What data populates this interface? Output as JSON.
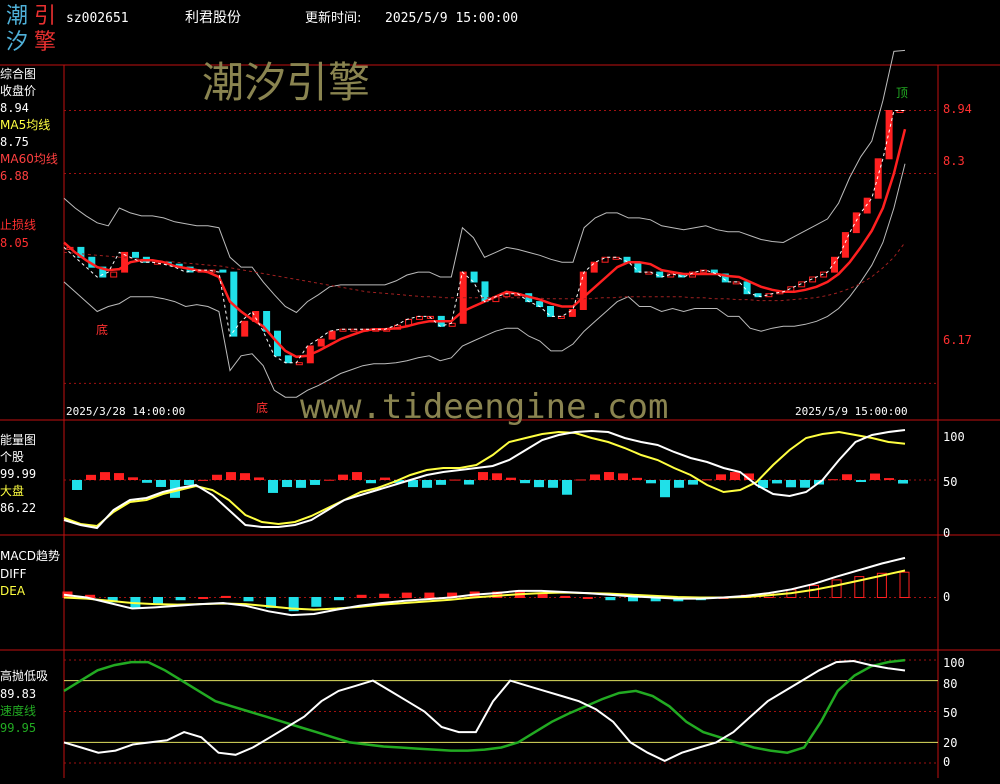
{
  "logo": {
    "chars": [
      "潮",
      "引",
      "汐",
      "擎"
    ]
  },
  "header": {
    "code": "sz002651",
    "name": "利君股份",
    "update_label": "更新时间:",
    "update_time": "2025/5/9 15:00:00"
  },
  "watermark": {
    "brand": "潮汐引擎",
    "url": "www.tideengine.com"
  },
  "colors": {
    "red": "#ff2020",
    "cyan": "#20e0e8",
    "yellow": "#ffff40",
    "green": "#22aa22",
    "frame": "#c01010"
  },
  "panel_main": {
    "title": "综合图",
    "close_label": "收盘价",
    "close_value": "8.94",
    "ma5_label": "MA5均线",
    "ma5_value": "8.75",
    "ma60_label": "MA60均线",
    "ma60_value": "6.88",
    "stop_label": "止损线",
    "stop_value": "8.05",
    "axis_labels": [
      "8.94",
      "8.3",
      "6.17"
    ],
    "date_start": "2025/3/28 14:00:00",
    "date_end": "2025/5/9 15:00:00",
    "marker_bottom": "底",
    "marker_top": "顶"
  },
  "panel_energy": {
    "title": "能量图",
    "stock_label": "个股",
    "stock_value": "99.99",
    "market_label": "大盘",
    "market_value": "86.22",
    "axis_labels": [
      "100",
      "50",
      "0"
    ]
  },
  "panel_macd": {
    "title": "MACD趋势",
    "diff_label": "DIFF",
    "dea_label": "DEA",
    "axis_labels": [
      "0"
    ]
  },
  "panel_speed": {
    "title": "高抛低吸",
    "value": "89.83",
    "speed_label": "速度线",
    "speed_value": "99.95",
    "axis_labels": [
      "100",
      "80",
      "50",
      "20",
      "0"
    ]
  },
  "chart_data": {
    "type": "line",
    "x_range": [
      "2025/3/28 14:00:00",
      "2025/5/9 15:00:00"
    ],
    "price_close": [
      7.55,
      7.45,
      7.35,
      7.25,
      7.3,
      7.5,
      7.45,
      7.4,
      7.4,
      7.38,
      7.35,
      7.3,
      7.32,
      7.32,
      7.3,
      6.65,
      6.8,
      6.9,
      6.7,
      6.45,
      6.38,
      6.38,
      6.55,
      6.62,
      6.7,
      6.72,
      6.72,
      6.72,
      6.72,
      6.72,
      6.76,
      6.82,
      6.85,
      6.85,
      6.75,
      6.78,
      7.3,
      7.2,
      7.0,
      7.05,
      7.08,
      7.08,
      7.0,
      6.95,
      6.85,
      6.85,
      6.92,
      7.3,
      7.4,
      7.45,
      7.45,
      7.4,
      7.3,
      7.3,
      7.25,
      7.28,
      7.25,
      7.3,
      7.32,
      7.28,
      7.2,
      7.2,
      7.08,
      7.05,
      7.08,
      7.1,
      7.15,
      7.2,
      7.25,
      7.3,
      7.45,
      7.7,
      7.9,
      8.05,
      8.45,
      8.94,
      8.94
    ],
    "ma5": [
      7.6,
      7.5,
      7.42,
      7.35,
      7.32,
      7.33,
      7.4,
      7.42,
      7.42,
      7.4,
      7.36,
      7.34,
      7.32,
      7.3,
      7.25,
      7.0,
      6.9,
      6.82,
      6.75,
      6.62,
      6.5,
      6.44,
      6.45,
      6.5,
      6.56,
      6.62,
      6.66,
      6.7,
      6.72,
      6.72,
      6.73,
      6.75,
      6.78,
      6.8,
      6.8,
      6.8,
      6.9,
      6.95,
      7.0,
      7.05,
      7.1,
      7.08,
      7.05,
      7.02,
      6.98,
      6.95,
      6.95,
      7.05,
      7.15,
      7.25,
      7.35,
      7.4,
      7.4,
      7.38,
      7.32,
      7.3,
      7.28,
      7.28,
      7.28,
      7.28,
      7.26,
      7.25,
      7.2,
      7.15,
      7.12,
      7.1,
      7.1,
      7.12,
      7.15,
      7.2,
      7.28,
      7.4,
      7.55,
      7.72,
      7.95,
      8.3,
      8.75
    ],
    "ma60": [
      7.5,
      7.49,
      7.48,
      7.47,
      7.46,
      7.45,
      7.44,
      7.43,
      7.42,
      7.41,
      7.4,
      7.39,
      7.38,
      7.37,
      7.36,
      7.34,
      7.32,
      7.3,
      7.28,
      7.26,
      7.24,
      7.22,
      7.2,
      7.18,
      7.16,
      7.14,
      7.12,
      7.1,
      7.09,
      7.08,
      7.07,
      7.06,
      7.05,
      7.05,
      7.04,
      7.04,
      7.04,
      7.04,
      7.04,
      7.04,
      7.04,
      7.04,
      7.04,
      7.03,
      7.03,
      7.03,
      7.03,
      7.03,
      7.04,
      7.04,
      7.05,
      7.05,
      7.05,
      7.05,
      7.05,
      7.05,
      7.04,
      7.04,
      7.03,
      7.03,
      7.02,
      7.02,
      7.01,
      7.01,
      7.01,
      7.02,
      7.03,
      7.04,
      7.06,
      7.09,
      7.13,
      7.18,
      7.25,
      7.34,
      7.45,
      7.6,
      6.88
    ],
    "stop_line": [
      8.05,
      8.05,
      8.05,
      8.05,
      8.05,
      8.05,
      8.05,
      8.05,
      8.05,
      8.05,
      8.05
    ],
    "energy_stock": [
      10,
      5,
      2,
      20,
      30,
      32,
      38,
      42,
      45,
      35,
      20,
      5,
      3,
      3,
      5,
      10,
      20,
      30,
      35,
      40,
      45,
      50,
      55,
      58,
      60,
      62,
      64,
      70,
      80,
      90,
      95,
      98,
      99,
      98,
      92,
      88,
      85,
      78,
      72,
      68,
      62,
      58,
      45,
      36,
      34,
      38,
      50,
      70,
      88,
      95,
      98,
      99.99
    ],
    "energy_market": [
      12,
      6,
      4,
      18,
      28,
      30,
      36,
      40,
      44,
      40,
      30,
      15,
      8,
      6,
      8,
      14,
      22,
      30,
      38,
      42,
      48,
      55,
      60,
      62,
      62,
      65,
      75,
      88,
      92,
      96,
      98,
      97,
      92,
      88,
      82,
      75,
      70,
      62,
      55,
      45,
      38,
      40,
      48,
      65,
      80,
      92,
      96,
      98,
      95,
      92,
      88,
      86.22
    ],
    "macd_diff": [
      0.05,
      0.0,
      -0.1,
      -0.2,
      -0.18,
      -0.15,
      -0.12,
      -0.1,
      -0.15,
      -0.25,
      -0.32,
      -0.3,
      -0.22,
      -0.15,
      -0.1,
      -0.06,
      -0.03,
      0.0,
      0.05,
      0.08,
      0.12,
      0.12,
      0.1,
      0.08,
      0.05,
      0.02,
      0.0,
      -0.02,
      -0.02,
      0.0,
      0.03,
      0.08,
      0.15,
      0.25,
      0.38,
      0.5,
      0.62,
      0.72
    ],
    "macd_dea": [
      0.0,
      -0.02,
      -0.06,
      -0.1,
      -0.12,
      -0.13,
      -0.12,
      -0.11,
      -0.12,
      -0.16,
      -0.2,
      -0.22,
      -0.2,
      -0.17,
      -0.13,
      -0.1,
      -0.07,
      -0.04,
      0.0,
      0.03,
      0.06,
      0.08,
      0.09,
      0.08,
      0.07,
      0.05,
      0.03,
      0.01,
      0.0,
      0.0,
      0.01,
      0.04,
      0.08,
      0.14,
      0.22,
      0.31,
      0.4,
      0.49
    ],
    "speed_fast": [
      20,
      15,
      10,
      12,
      18,
      20,
      22,
      30,
      25,
      10,
      8,
      15,
      25,
      35,
      45,
      60,
      70,
      75,
      80,
      70,
      60,
      50,
      35,
      30,
      30,
      60,
      80,
      75,
      70,
      65,
      60,
      52,
      40,
      20,
      10,
      2,
      10,
      15,
      20,
      30,
      45,
      60,
      70,
      80,
      90,
      98,
      99,
      95,
      92,
      89.83
    ],
    "speed_slow": [
      70,
      80,
      90,
      95,
      98,
      98,
      90,
      80,
      70,
      60,
      55,
      50,
      45,
      40,
      35,
      30,
      25,
      20,
      18,
      16,
      15,
      14,
      13,
      12,
      12,
      13,
      15,
      20,
      30,
      40,
      48,
      55,
      62,
      68,
      70,
      65,
      55,
      40,
      30,
      25,
      20,
      15,
      12,
      10,
      15,
      40,
      70,
      85,
      94,
      98,
      99.95
    ]
  }
}
